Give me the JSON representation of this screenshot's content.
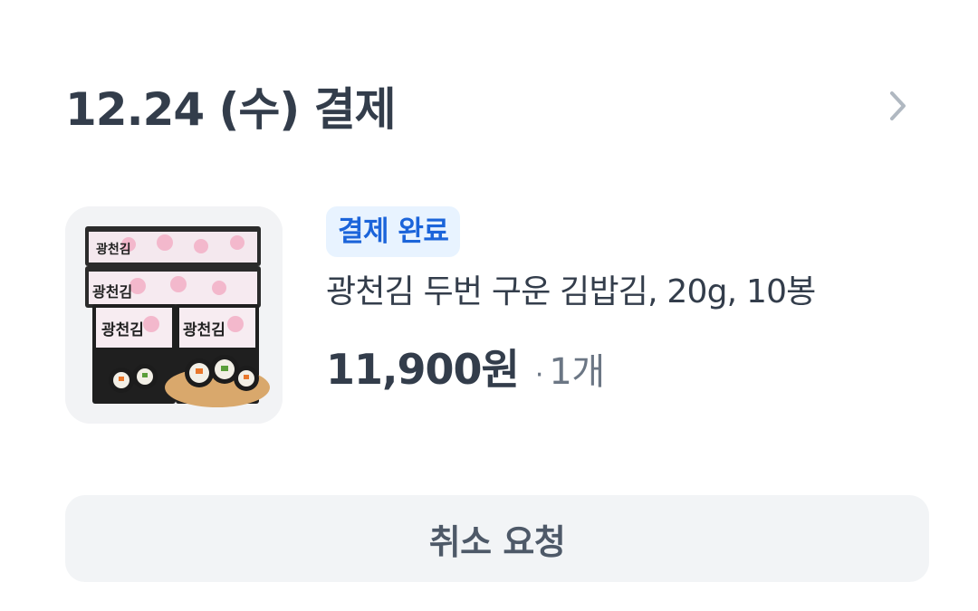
{
  "order": {
    "date_title": "12.24 (수) 결제",
    "chevron_icon": "chevron-right-icon"
  },
  "product": {
    "image_icon": "product-image-seaweed",
    "status_badge": "결제 완료",
    "name": "광천김 두번 구운 김밥김, 20g, 10봉",
    "price": "11,900원",
    "dot": "·",
    "quantity": "1개"
  },
  "actions": {
    "cancel_label": "취소 요청"
  },
  "colors": {
    "title_text": "#333d4b",
    "badge_bg": "#e8f3ff",
    "badge_text": "#1b64da",
    "button_bg": "#f2f4f6",
    "button_text": "#4e5968",
    "muted_text": "#6b7684",
    "chevron": "#b0b8c1"
  }
}
